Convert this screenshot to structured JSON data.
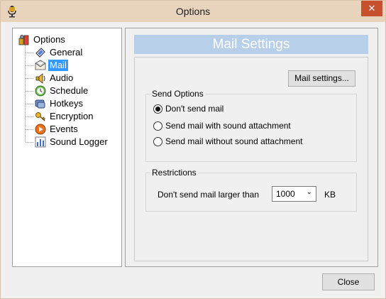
{
  "window": {
    "title": "Options",
    "close_glyph": "✕"
  },
  "tree": {
    "root": "Options",
    "items": [
      {
        "label": "General",
        "icon": "general-icon"
      },
      {
        "label": "Mail",
        "icon": "mail-icon",
        "selected": true
      },
      {
        "label": "Audio",
        "icon": "speaker-icon"
      },
      {
        "label": "Schedule",
        "icon": "clock-icon"
      },
      {
        "label": "Hotkeys",
        "icon": "hotkeys-icon"
      },
      {
        "label": "Encryption",
        "icon": "key-icon"
      },
      {
        "label": "Events",
        "icon": "play-icon"
      },
      {
        "label": "Sound Logger",
        "icon": "chart-icon"
      }
    ]
  },
  "panel": {
    "header": "Mail Settings",
    "mail_settings_button": "Mail settings...",
    "send_options": {
      "legend": "Send Options",
      "options": [
        {
          "label": "Don't send mail",
          "checked": true
        },
        {
          "label": "Send mail with sound attachment",
          "checked": false
        },
        {
          "label": "Send mail without sound attachment",
          "checked": false
        }
      ]
    },
    "restrictions": {
      "legend": "Restrictions",
      "label": "Don't send mail larger than",
      "value": "1000",
      "unit": "KB"
    }
  },
  "footer": {
    "close_button": "Close"
  },
  "colors": {
    "titlebar": "#e8d4bc",
    "close": "#c7502f",
    "header": "#b7cfe9",
    "selection": "#3399ff"
  }
}
